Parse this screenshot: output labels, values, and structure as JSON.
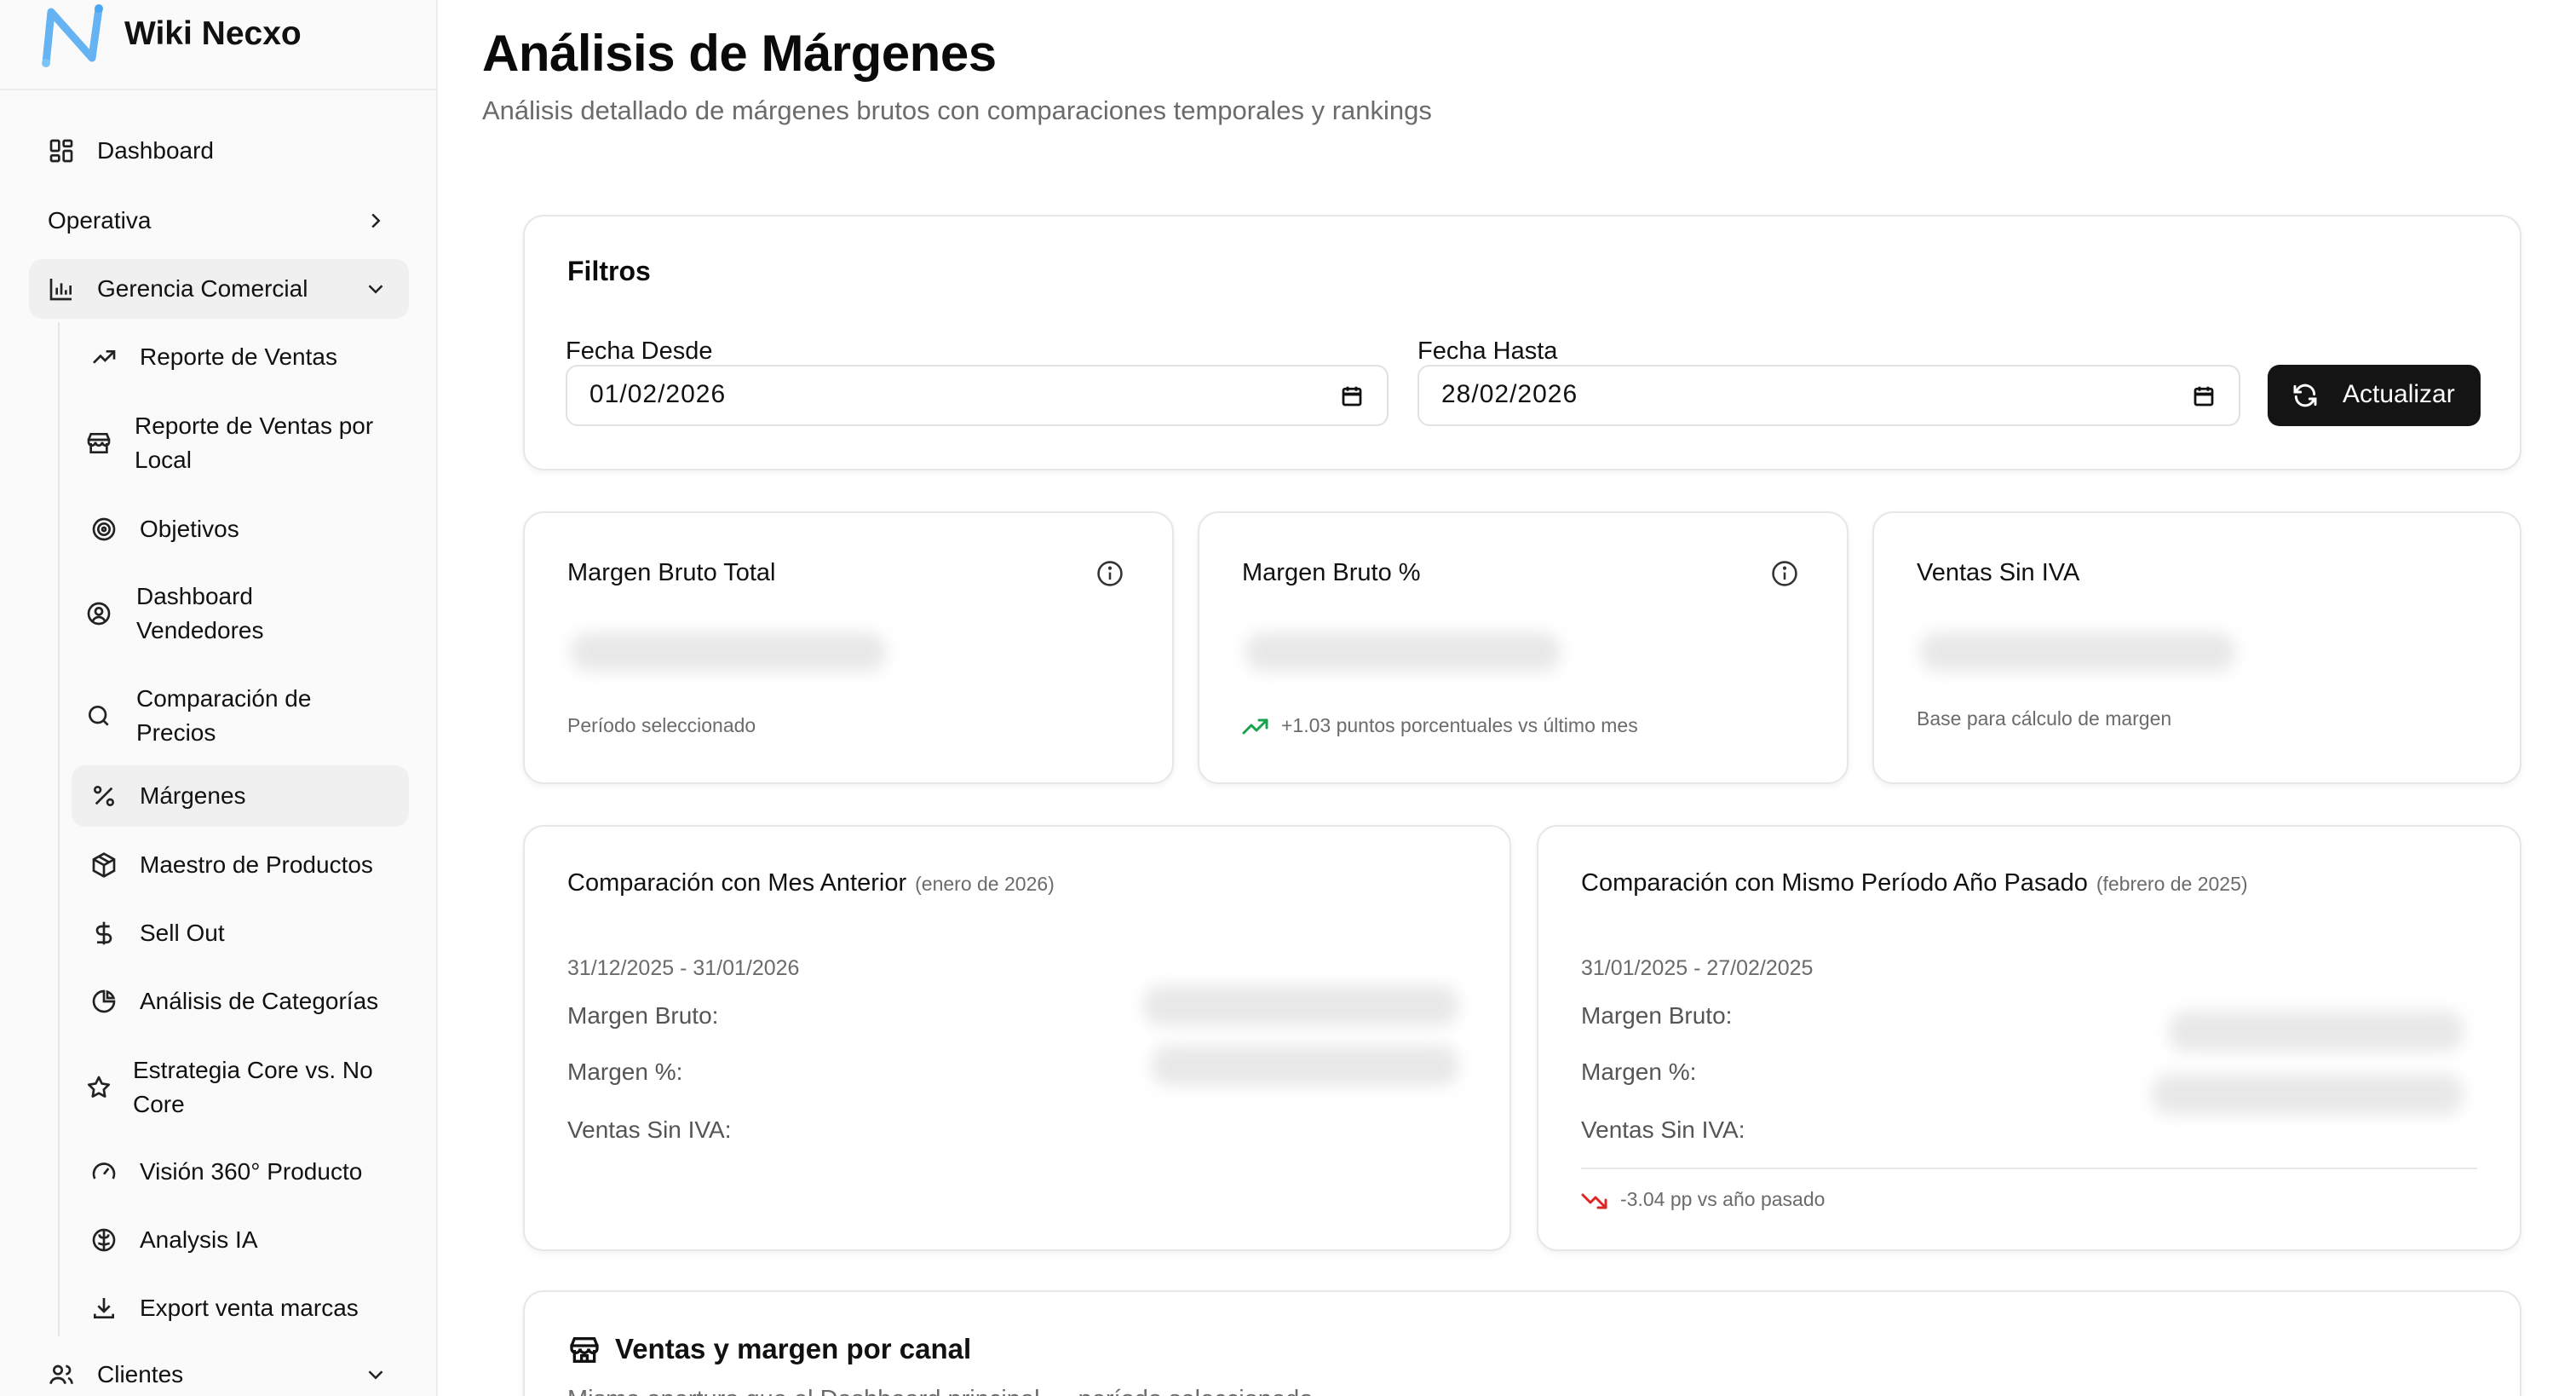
{
  "app": {
    "name": "Wiki Necxo",
    "colors": {
      "accent": "#141414",
      "positive": "#16a34a",
      "negative": "#dc2626",
      "logo": "#4aa6f0"
    }
  },
  "sidebar": {
    "items": [
      {
        "label": "Dashboard",
        "icon": "layout-grid-icon"
      },
      {
        "label": "Operativa",
        "icon": "chevron-right-icon"
      },
      {
        "label": "Gerencia Comercial",
        "icon": "bar-chart-icon"
      },
      {
        "label": "Reporte de Ventas",
        "icon": "trending-up-icon"
      },
      {
        "label": "Reporte de Ventas por",
        "label2": "Local",
        "icon": "store-icon"
      },
      {
        "label": "Objetivos",
        "icon": "target-icon"
      },
      {
        "label": "Dashboard",
        "label2": "Vendedores",
        "icon": "user-circle-icon"
      },
      {
        "label": "Comparación de",
        "label2": "Precios",
        "icon": "search-icon"
      },
      {
        "label": "Márgenes",
        "icon": "percent-icon"
      },
      {
        "label": "Maestro de Productos",
        "icon": "package-icon"
      },
      {
        "label": "Sell Out",
        "icon": "dollar-icon"
      },
      {
        "label": "Análisis de Categorías",
        "icon": "pie-chart-icon"
      },
      {
        "label": "Estrategia Core vs. No",
        "label2": "Core",
        "icon": "star-icon"
      },
      {
        "label": "Visión 360° Producto",
        "icon": "gauge-icon"
      },
      {
        "label": "Analysis IA",
        "icon": "brain-icon"
      },
      {
        "label": "Export venta marcas",
        "icon": "download-icon"
      },
      {
        "label": "Clientes",
        "icon": "users-icon"
      }
    ]
  },
  "header": {
    "title": "Análisis de Márgenes",
    "subtitle": "Análisis detallado de márgenes brutos con comparaciones temporales y rankings"
  },
  "filters": {
    "title": "Filtros",
    "from_label": "Fecha Desde",
    "from_value": "01/02/2026",
    "to_label": "Fecha Hasta",
    "to_value": "28/02/2026",
    "update_label": "Actualizar"
  },
  "kpis": [
    {
      "title": "Margen Bruto Total",
      "footer": "Período seleccionado"
    },
    {
      "title": "Margen Bruto %",
      "footer": "+1.03 puntos porcentuales vs último mes"
    },
    {
      "title": "Ventas Sin IVA",
      "footer": "Base para cálculo de margen"
    }
  ],
  "comparisons": [
    {
      "title": "Comparación con Mes Anterior",
      "period": "(enero de 2026)",
      "range": "31/12/2025 - 31/01/2026",
      "rows": [
        "Margen Bruto:",
        "Margen %:",
        "Ventas Sin IVA:"
      ]
    },
    {
      "title": "Comparación con Mismo Período Año Pasado",
      "period": "(febrero de 2025)",
      "range": "31/01/2025 - 27/02/2025",
      "rows": [
        "Margen Bruto:",
        "Margen %:",
        "Ventas Sin IVA:"
      ],
      "footer": "-3.04 pp vs año pasado"
    }
  ],
  "channel": {
    "title": "Ventas y margen por canal",
    "subtitle": "Misma apertura que el Dashboard principal — período seleccionado"
  }
}
